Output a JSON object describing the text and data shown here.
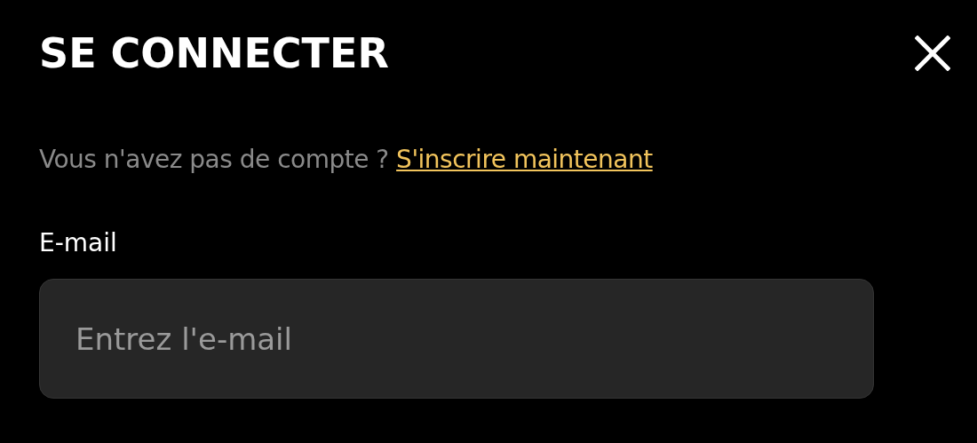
{
  "dialog": {
    "title": "SE CONNECTER"
  },
  "signup_prompt": {
    "text": "Vous n'avez pas de compte ?",
    "link": "S'inscrire maintenant"
  },
  "email_field": {
    "label": "E-mail",
    "placeholder": "Entrez l'e-mail"
  }
}
